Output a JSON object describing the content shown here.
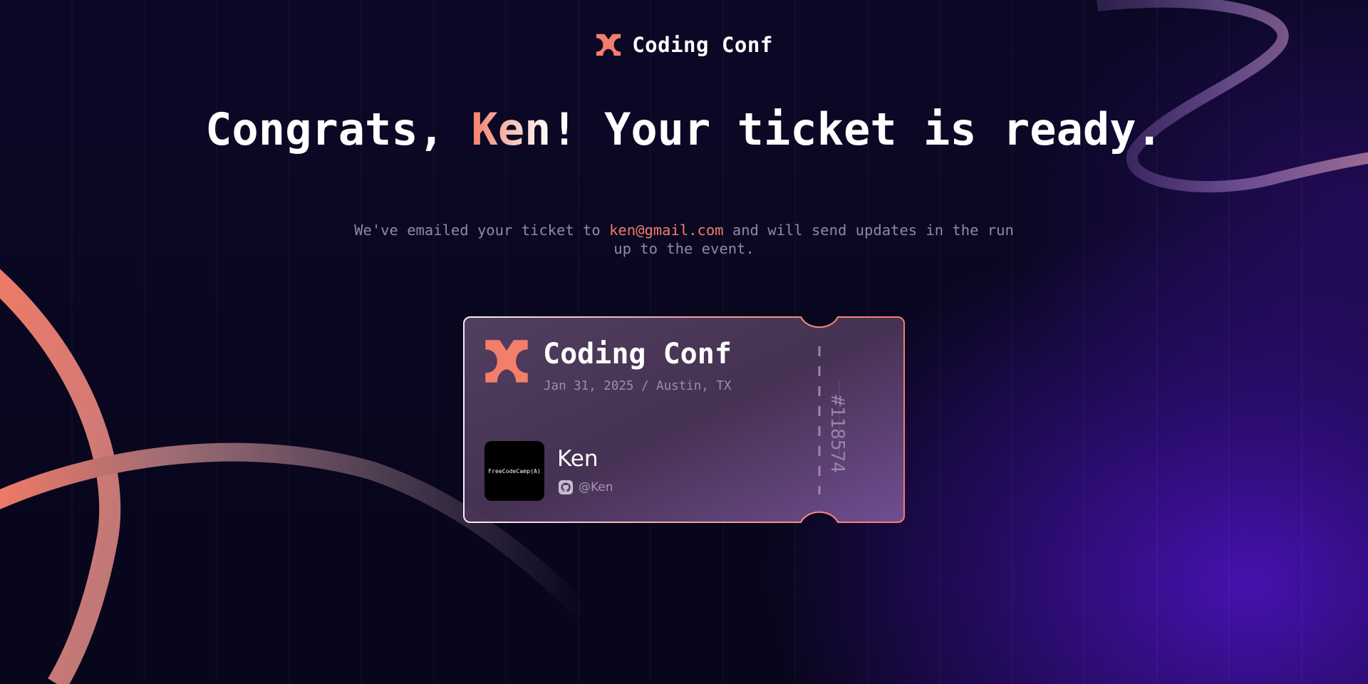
{
  "header": {
    "brand": "Coding Conf"
  },
  "hero": {
    "title_prefix": "Congrats, ",
    "title_name": "Ken",
    "title_suffix": "! Your ticket is ready.",
    "subtitle_prefix": "We've emailed your ticket to ",
    "subtitle_email": "ken@gmail.com",
    "subtitle_suffix": " and will send updates in the run up to the event."
  },
  "ticket": {
    "brand": "Coding Conf",
    "date_location": "Jan 31, 2025 / Austin, TX",
    "avatar_text": "FreeCodeCamp(A)",
    "attendee_name": "Ken",
    "github_handle": "@Ken",
    "ticket_number": "#118574"
  },
  "colors": {
    "accent": "#f37e6a",
    "background": "#07061a",
    "muted_text": "#8e89a8"
  },
  "icons": {
    "logo": "coding-conf-logo-icon",
    "github": "github-icon"
  }
}
